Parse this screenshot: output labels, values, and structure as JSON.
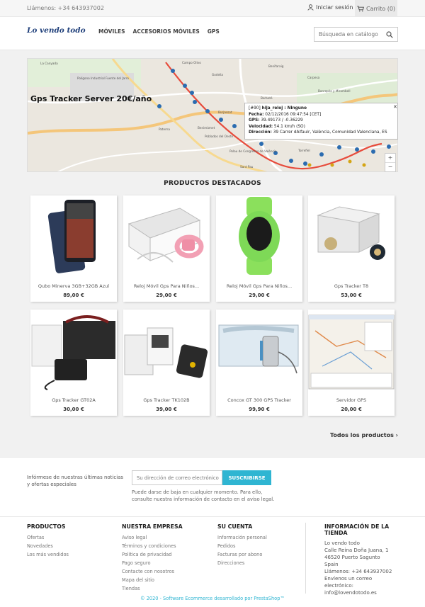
{
  "topbar": {
    "phone": "Llámenos: +34 643937002",
    "login_label": "Iniciar sesión",
    "cart_label": "Carrito (0)"
  },
  "header": {
    "logo": "Lo vendo todo",
    "nav": [
      "MÓVILES",
      "ACCESORIOS MÓVILES",
      "GPS"
    ],
    "search_placeholder": "Búsqueda en catálogo"
  },
  "banner": {
    "title": "Gps Tracker Server 20€/año",
    "popup": {
      "line1_id": "[#90]",
      "line1_name": "hija_reloj : Ninguno",
      "fecha_label": "Fecha:",
      "fecha": "02/12/2016 09:47:54 [CET]",
      "gps_label": "GPS:",
      "gps": "39.49173 / -0.36229",
      "velocidad_label": "Velocidad:",
      "velocidad": "54.1 km/h (SO)",
      "direccion_label": "Dirección:",
      "direccion": "39 Carrer dAlfauir, València, Comunidad Valenciana, ES"
    },
    "map_labels": [
      "La Canyada",
      "Campo Olivo",
      "Benifaraig",
      "Polígono Industrial Fuente del Jarro",
      "Godella",
      "Burjassot",
      "Paterna",
      "Benimàmet",
      "Borbotó",
      "Carpesa",
      "Bonrepòs y Mirambell",
      "Alboraya",
      "Poblados del Oeste",
      "Polau de Congresos de València",
      "Torrefiel",
      "Sant Pau"
    ]
  },
  "featured_title": "PRODUCTOS DESTACADOS",
  "products": [
    {
      "name": "Qubo Minerva 3GB+32GB Azul",
      "price": "89,00 €"
    },
    {
      "name": "Reloj Móvil Gps Para Niños...",
      "price": "29,00 €"
    },
    {
      "name": "Reloj Móvil Gps Para Niños...",
      "price": "29,00 €"
    },
    {
      "name": "Gps Tracker T8",
      "price": "53,00 €"
    },
    {
      "name": "Gps Tracker GT02A",
      "price": "30,00 €"
    },
    {
      "name": "Gps Tracker TK102B",
      "price": "39,00 €"
    },
    {
      "name": "Concox GT 300 GPS Tracker",
      "price": "99,90 €"
    },
    {
      "name": "Servidor GPS",
      "price": "20,00 €"
    }
  ],
  "all_products": "Todos los productos",
  "newsletter": {
    "text": "Infórmese de nuestras últimas noticias y ofertas especiales",
    "placeholder": "Su dirección de correo electrónico",
    "button": "SUSCRIBIRSE",
    "note": "Puede darse de baja en cualquier momento. Para ello, consulte nuestra información de contacto en el aviso legal."
  },
  "footer": {
    "productos": {
      "title": "PRODUCTOS",
      "links": [
        "Ofertas",
        "Novedades",
        "Los más vendidos"
      ]
    },
    "empresa": {
      "title": "NUESTRA EMPRESA",
      "links": [
        "Aviso legal",
        "Términos y condiciones",
        "Política de privacidad",
        "Pago seguro",
        "Contacte con nosotros",
        "Mapa del sitio",
        "Tiendas"
      ]
    },
    "cuenta": {
      "title": "SU CUENTA",
      "links": [
        "Información personal",
        "Pedidos",
        "Facturas por abono",
        "Direcciones"
      ]
    },
    "tienda": {
      "title": "INFORMACIÓN DE LA TIENDA",
      "lines": [
        "Lo vendo todo",
        "Calle Reina Doña Juana, 1",
        "46520 Puerto Sagunto",
        "Spain",
        "Llámenos: +34 643937002",
        "Envíenos un correo electrónico:",
        "info@lovendotodo.es"
      ]
    },
    "copyright": "© 2020 - Software Ecommerce desarrollado por PrestaShop™"
  },
  "colors": {
    "accent": "#2fb5d2",
    "logo": "#1f3f7a"
  }
}
